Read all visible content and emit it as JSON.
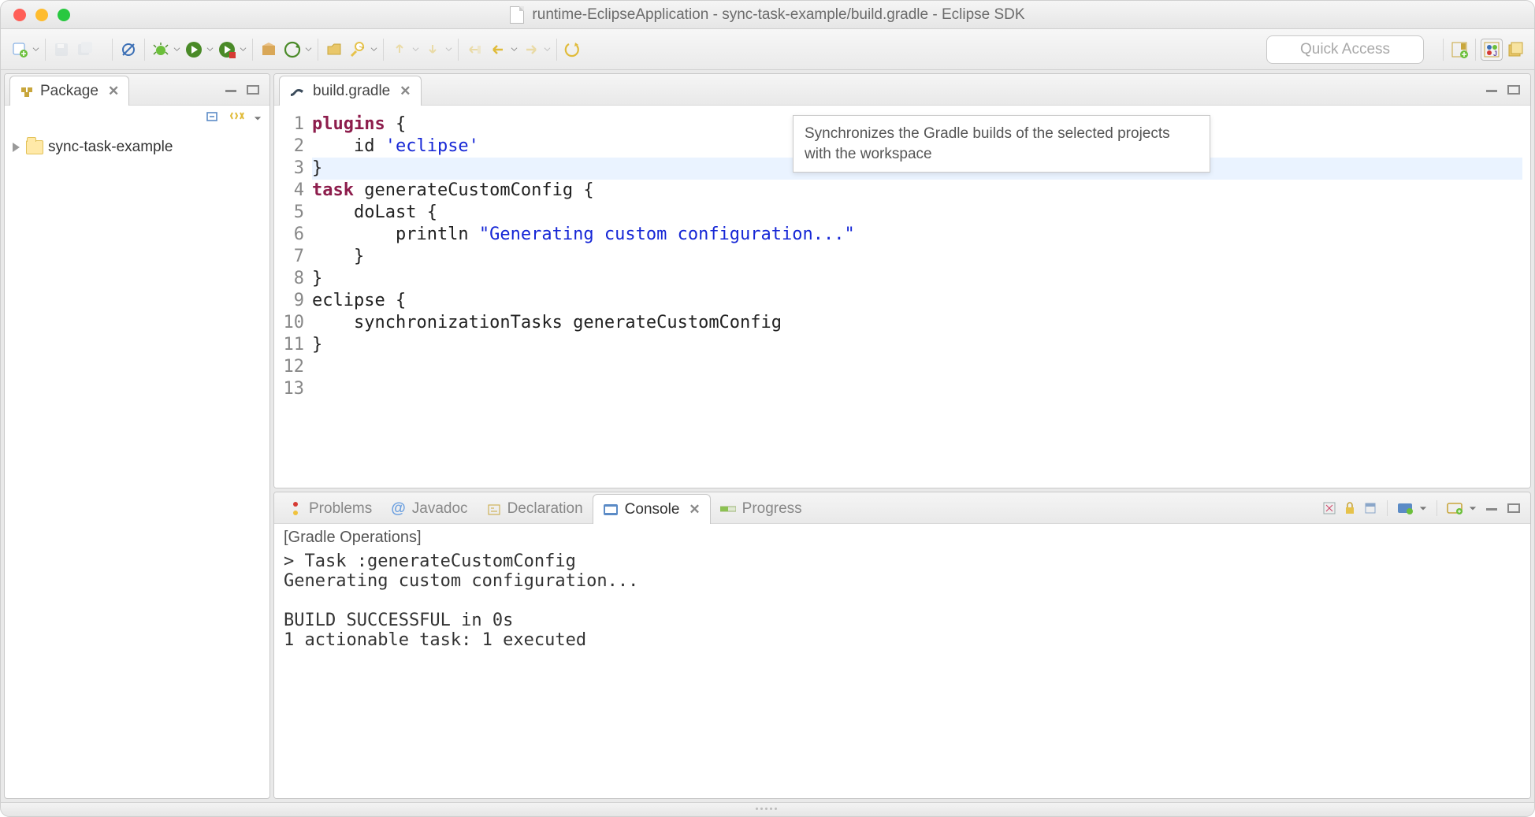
{
  "titlebar": {
    "title": "runtime-EclipseApplication - sync-task-example/build.gradle - Eclipse SDK"
  },
  "toolbar": {
    "quick_access": "Quick Access",
    "tooltip_text": "Synchronizes the Gradle builds of the selected projects with the workspace"
  },
  "package_view": {
    "title": "Package",
    "project_name": "sync-task-example"
  },
  "editor": {
    "filename": "build.gradle",
    "lines": {
      "n1": "1",
      "l1a": "plugins",
      "l1b": " {",
      "n2": "2",
      "l2a": "    id ",
      "l2b": "'eclipse'",
      "n3": "3",
      "l3": "}",
      "n4": "4",
      "l4": "",
      "n5": "5",
      "l5a": "task",
      "l5b": " generateCustomConfig {",
      "n6": "6",
      "l6": "    doLast {",
      "n7": "7",
      "l7a": "        println ",
      "l7b": "\"Generating custom configuration...\"",
      "n8": "8",
      "l8": "    }",
      "n9": "9",
      "l9": "}",
      "n10": "10",
      "l10": "",
      "n11": "11",
      "l11": "eclipse {",
      "n12": "12",
      "l12": "    synchronizationTasks generateCustomConfig",
      "n13": "13",
      "l13": "}"
    }
  },
  "bottom_tabs": {
    "problems": "Problems",
    "javadoc": "Javadoc",
    "declaration": "Declaration",
    "console": "Console",
    "progress": "Progress"
  },
  "console": {
    "title": "[Gradle Operations]",
    "body": "> Task :generateCustomConfig\nGenerating custom configuration...\n\nBUILD SUCCESSFUL in 0s\n1 actionable task: 1 executed"
  }
}
